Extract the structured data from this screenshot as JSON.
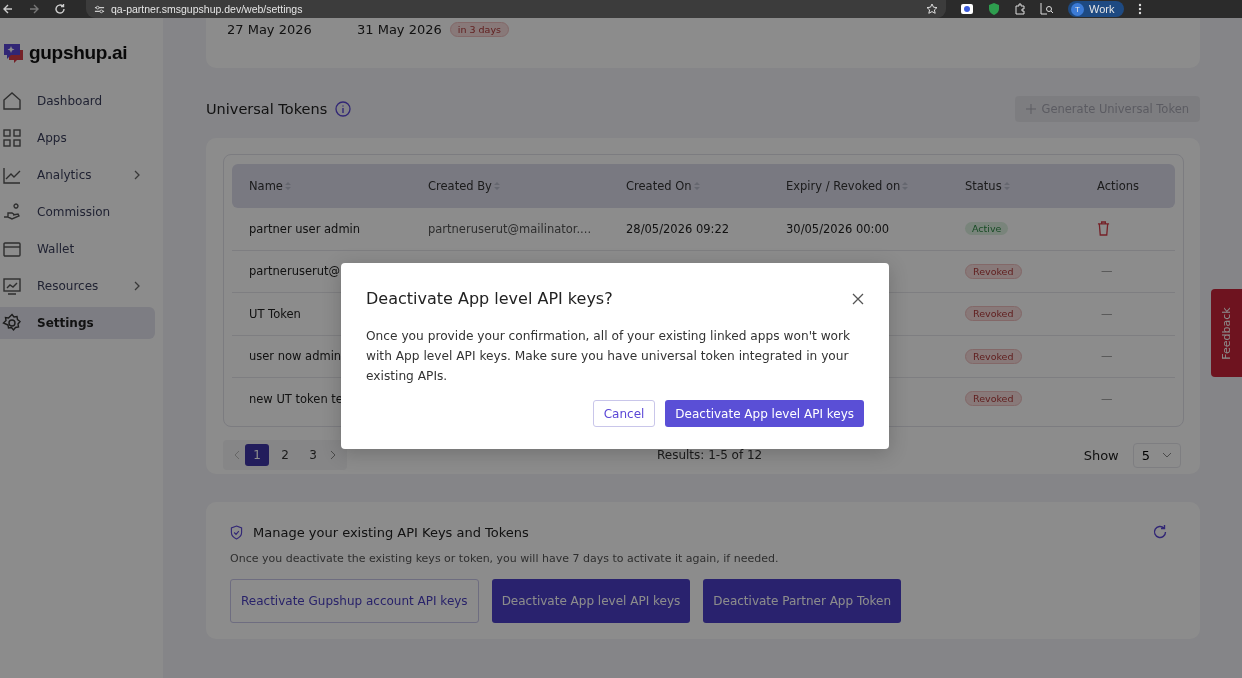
{
  "browser": {
    "url": "qa-partner.smsgupshup.dev/web/settings",
    "profile_initial": "T",
    "profile": "Work"
  },
  "sidebar": {
    "brand": "gupshup.ai",
    "items": [
      {
        "label": "Dashboard",
        "expandable": false,
        "selected": false
      },
      {
        "label": "Apps",
        "expandable": false,
        "selected": false
      },
      {
        "label": "Analytics",
        "expandable": true,
        "selected": false
      },
      {
        "label": "Commission",
        "expandable": false,
        "selected": false
      },
      {
        "label": "Wallet",
        "expandable": false,
        "selected": false
      },
      {
        "label": "Resources",
        "expandable": true,
        "selected": false
      },
      {
        "label": "Settings",
        "expandable": false,
        "selected": true
      }
    ]
  },
  "top_card": {
    "dates": [
      "27 May 2026",
      "31 May 2026"
    ],
    "badge": "in 3 days"
  },
  "universal_tokens": {
    "title": "Universal Tokens",
    "generate_button": {
      "label": "Generate Universal Token",
      "disabled": true
    },
    "table": {
      "columns": [
        {
          "label": "Name",
          "sortable": true
        },
        {
          "label": "Created By",
          "sortable": true
        },
        {
          "label": "Created On",
          "sortable": true
        },
        {
          "label": "Expiry / Revoked on",
          "sortable": true
        },
        {
          "label": "Status",
          "sortable": true
        },
        {
          "label": "Actions",
          "sortable": false
        }
      ],
      "rows": [
        {
          "name": "partner user admin",
          "created_by": "partneruserut@mailinator....",
          "created_on": "28/05/2026 09:22",
          "expiry": "30/05/2026 00:00",
          "status": "Active",
          "kind": "active"
        },
        {
          "name": "partneruserut@",
          "status": "Revoked",
          "kind": "revoked",
          "action": "—"
        },
        {
          "name": "UT Token",
          "status": "Revoked",
          "kind": "revoked",
          "action": "—"
        },
        {
          "name": "user now admin",
          "status": "Revoked",
          "kind": "revoked",
          "action": "—"
        },
        {
          "name": "new UT token te",
          "status": "Revoked",
          "kind": "revoked",
          "action": "—"
        }
      ]
    },
    "pagination": {
      "pages": [
        {
          "label": "1",
          "selected": true
        },
        {
          "label": "2",
          "selected": false
        },
        {
          "label": "3",
          "selected": false
        }
      ],
      "results": "Results: 1-5 of 12",
      "show_label": "Show",
      "page_size": "5"
    }
  },
  "manage": {
    "title": "Manage your existing API Keys and Tokens",
    "note": "Once you deactivate the existing keys or token, you will have 7 days to activate it again, if needed.",
    "buttons": [
      {
        "label": "Reactivate Gupshup account API keys",
        "kind": "outline"
      },
      {
        "label": "Deactivate App level API keys",
        "kind": "primary"
      },
      {
        "label": "Deactivate Partner App Token",
        "kind": "primary"
      }
    ]
  },
  "feedback": "Feedback",
  "modal": {
    "title": "Deactivate App level API keys?",
    "body": "Once you provide your confirmation, all of your existing linked apps won't work with App level API keys. Make sure you have universal token integrated in your existing APIs.",
    "cancel": "Cancel",
    "confirm": "Deactivate App level API keys"
  }
}
